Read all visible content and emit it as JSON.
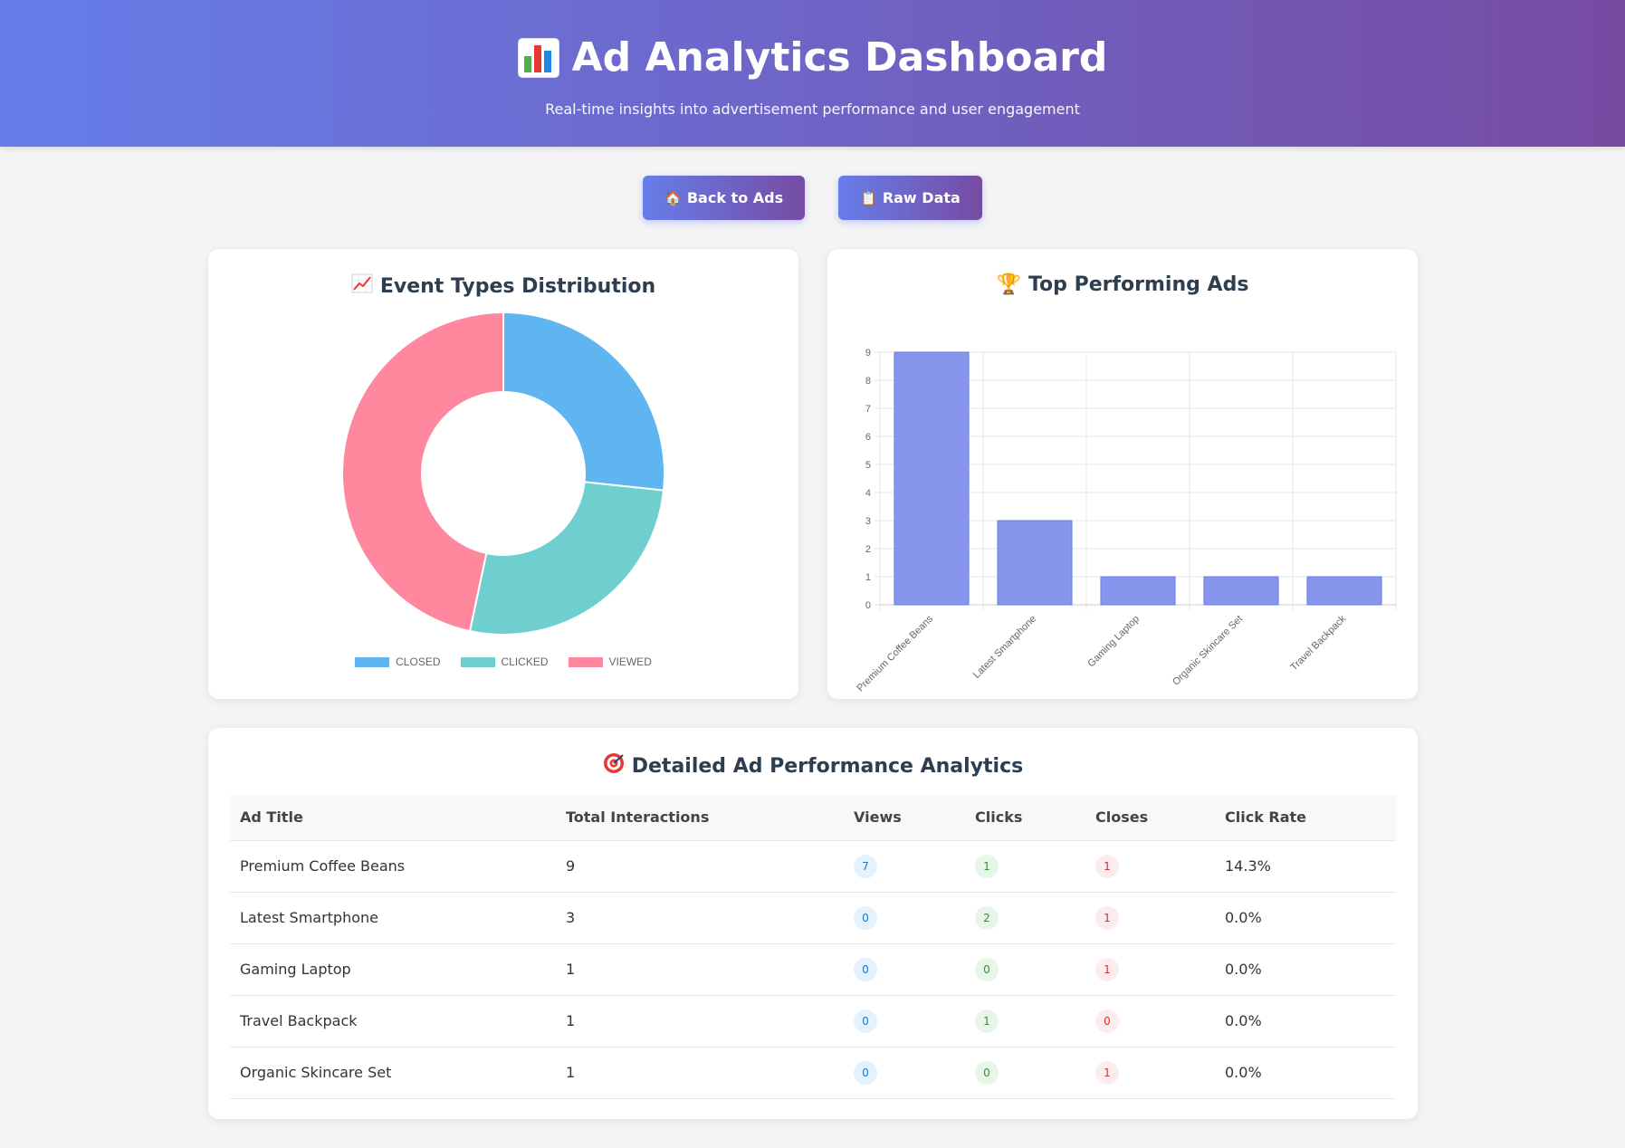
{
  "header": {
    "title": "Ad Analytics Dashboard",
    "subtitle": "Real-time insights into advertisement performance and user engagement",
    "icon": "bar-chart-icon"
  },
  "actions": {
    "back_label": "Back to Ads",
    "back_icon": "house-icon",
    "raw_label": "Raw Data",
    "raw_icon": "clipboard-icon"
  },
  "event_chart": {
    "title": "Event Types Distribution",
    "icon": "chart-increasing-icon"
  },
  "top_chart": {
    "title": "Top Performing Ads",
    "icon": "trophy-icon"
  },
  "table": {
    "title": "Detailed Ad Performance Analytics",
    "icon": "target-icon",
    "columns": [
      "Ad Title",
      "Total Interactions",
      "Views",
      "Clicks",
      "Closes",
      "Click Rate"
    ],
    "rows": [
      {
        "title": "Premium Coffee Beans",
        "total": "9",
        "views": "7",
        "clicks": "1",
        "closes": "1",
        "rate": "14.3%"
      },
      {
        "title": "Latest Smartphone",
        "total": "3",
        "views": "0",
        "clicks": "2",
        "closes": "1",
        "rate": "0.0%"
      },
      {
        "title": "Gaming Laptop",
        "total": "1",
        "views": "0",
        "clicks": "0",
        "closes": "1",
        "rate": "0.0%"
      },
      {
        "title": "Travel Backpack",
        "total": "1",
        "views": "0",
        "clicks": "1",
        "closes": "0",
        "rate": "0.0%"
      },
      {
        "title": "Organic Skincare Set",
        "total": "1",
        "views": "0",
        "clicks": "0",
        "closes": "1",
        "rate": "0.0%"
      }
    ]
  },
  "colors": {
    "closed": "#5eb5ef",
    "clicked": "#6fcfcf",
    "viewed": "#ff879e",
    "bar": "#8796ec",
    "bar_border": "#667eea",
    "accent_start": "#667eea",
    "accent_end": "#764ba2"
  },
  "chart_data": [
    {
      "type": "pie",
      "donut": true,
      "categories": [
        "CLOSED",
        "CLICKED",
        "VIEWED"
      ],
      "values": [
        4,
        4,
        7
      ],
      "legend": "bottom"
    },
    {
      "type": "bar",
      "categories": [
        "Premium Coffee Beans",
        "Latest Smartphone",
        "Gaming Laptop",
        "Organic Skincare Set",
        "Travel Backpack"
      ],
      "values": [
        9,
        3,
        1,
        1,
        1
      ],
      "ylim": [
        0,
        9
      ],
      "yticks": [
        0,
        1,
        2,
        3,
        4,
        5,
        6,
        7,
        8,
        9
      ],
      "grid": true,
      "legend": "none"
    }
  ]
}
